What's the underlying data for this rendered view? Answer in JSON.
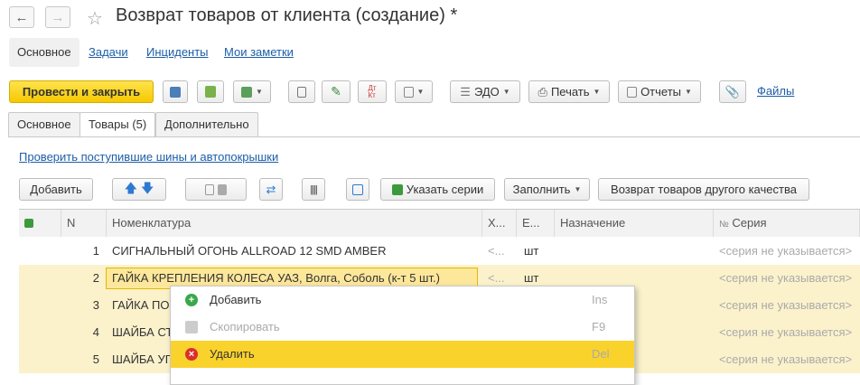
{
  "window": {
    "title": "Возврат товаров от клиента (создание)",
    "modified_mark": "*"
  },
  "top_tabs": [
    {
      "label": "Основное"
    },
    {
      "label": "Задачи"
    },
    {
      "label": "Инциденты"
    },
    {
      "label": "Мои заметки"
    }
  ],
  "toolbar": {
    "post_close": "Провести и закрыть",
    "edo": "ЭДО",
    "print": "Печать",
    "reports": "Отчеты",
    "files": "Файлы"
  },
  "sub_tabs": [
    {
      "label": "Основное"
    },
    {
      "label": "Товары (5)"
    },
    {
      "label": "Дополнительно"
    }
  ],
  "check_link": "Проверить поступившие шины и автопокрышки",
  "table_toolbar": {
    "add": "Добавить",
    "specify_series": "Указать серии",
    "fill": "Заполнить",
    "return_other_quality": "Возврат товаров другого качества"
  },
  "table": {
    "headers": {
      "n": "N",
      "nomenclature": "Номенклатура",
      "char": "Х...",
      "unit": "Е...",
      "purpose": "Назначение",
      "series": "Серия"
    },
    "rows": [
      {
        "n": "1",
        "name": "СИГНАЛЬНЫЙ ОГОНЬ ALLROAD 12 SMD AMBER",
        "char": "<...",
        "unit": "шт",
        "series": "<серия не указывается>"
      },
      {
        "n": "2",
        "name": "ГАЙКА КРЕПЛЕНИЯ КОЛЕСА УАЗ, Волга, Соболь (к-т 5 шт.)",
        "char": "<...",
        "unit": "шт",
        "series": "<серия не указывается>"
      },
      {
        "n": "3",
        "name": "ГАЙКА ПО",
        "series": "<серия не указывается>"
      },
      {
        "n": "4",
        "name": "ШАЙБА СТ",
        "series": "<серия не указывается>"
      },
      {
        "n": "5",
        "name": "ШАЙБА УГ",
        "series": "<серия не указывается>"
      }
    ]
  },
  "context_menu": [
    {
      "label": "Добавить",
      "shortcut": "Ins"
    },
    {
      "label": "Скопировать",
      "shortcut": "F9"
    },
    {
      "label": "Удалить",
      "shortcut": "Del"
    }
  ],
  "colors": {
    "accent_yellow": "#f5c800",
    "link": "#1c5ea6",
    "row_highlight": "#fbf2cc",
    "menu_highlight": "#fad22c"
  }
}
